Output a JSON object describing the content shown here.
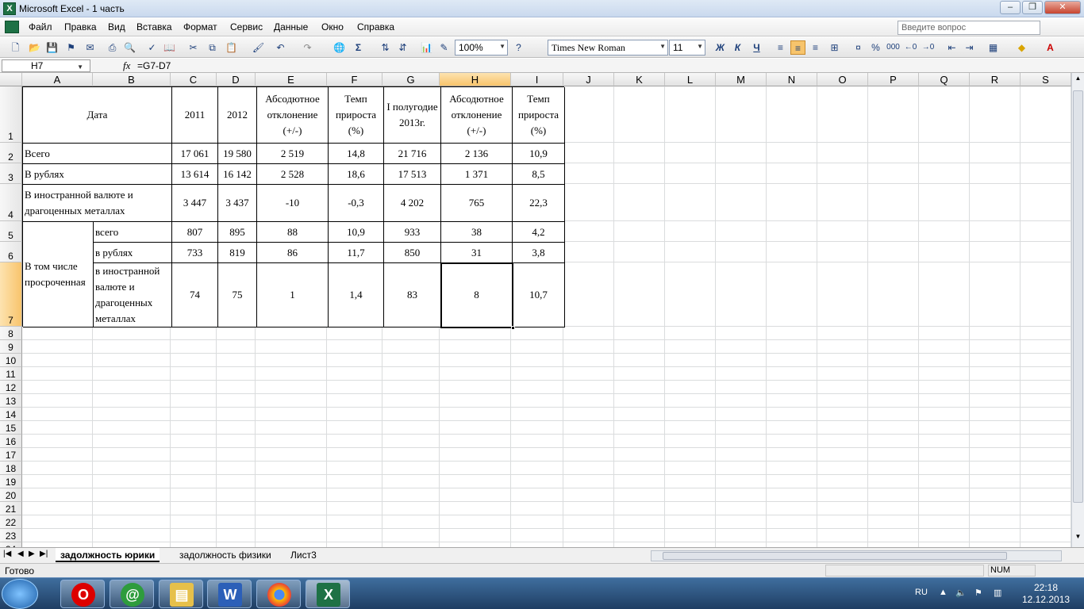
{
  "window": {
    "title": "Microsoft Excel - 1 часть",
    "app_icon": "X",
    "min": "–",
    "restore": "❐",
    "close": "✕"
  },
  "menu": {
    "items": [
      "Файл",
      "Правка",
      "Вид",
      "Вставка",
      "Формат",
      "Сервис",
      "Данные",
      "Окно",
      "Справка"
    ],
    "help_placeholder": "Введите вопрос"
  },
  "toolbar": {
    "zoom": "100%",
    "font": "Times New Roman",
    "size": "11",
    "bold": "Ж",
    "italic": "К",
    "underline": "Ч",
    "sigma": "Σ"
  },
  "formula": {
    "cell_ref": "H7",
    "fx": "fx",
    "value": "=G7-D7"
  },
  "columns": [
    "A",
    "B",
    "C",
    "D",
    "E",
    "F",
    "G",
    "H",
    "I",
    "J",
    "K",
    "L",
    "M",
    "N",
    "O",
    "P",
    "Q",
    "R",
    "S"
  ],
  "selected_column": "H",
  "rows": [
    "1",
    "2",
    "3",
    "4",
    "5",
    "6",
    "7",
    "8",
    "9",
    "10",
    "11",
    "12",
    "13",
    "14",
    "15",
    "16",
    "17",
    "18",
    "19",
    "20",
    "21",
    "22",
    "23",
    "24"
  ],
  "selected_row": "7",
  "table": {
    "header": {
      "date": "Дата",
      "y2011": "2011",
      "y2012": "2012",
      "abs1": "Абсодютное отклонение (+/-)",
      "rate1": "Темп прироста (%)",
      "h2013": "I полугодие 2013г.",
      "abs2": "Абсодютное отклонение (+/-)",
      "rate2": "Темп прироста (%)"
    },
    "r2": {
      "label": "Всего",
      "c": "17 061",
      "d": "19 580",
      "e": "2 519",
      "f": "14,8",
      "g": "21 716",
      "h": "2 136",
      "i": "10,9"
    },
    "r3": {
      "label": "В рублях",
      "c": "13 614",
      "d": "16 142",
      "e": "2 528",
      "f": "18,6",
      "g": "17 513",
      "h": "1 371",
      "i": "8,5"
    },
    "r4": {
      "label": "В иностранной валюте и драгоценных металлах",
      "c": "3 447",
      "d": "3 437",
      "e": "-10",
      "f": "-0,3",
      "g": "4 202",
      "h": "765",
      "i": "22,3"
    },
    "group_label": "В том числе просроченная",
    "r5": {
      "label": "всего",
      "c": "807",
      "d": "895",
      "e": "88",
      "f": "10,9",
      "g": "933",
      "h": "38",
      "i": "4,2"
    },
    "r6": {
      "label": "в рублях",
      "c": "733",
      "d": "819",
      "e": "86",
      "f": "11,7",
      "g": "850",
      "h": "31",
      "i": "3,8"
    },
    "r7": {
      "label": "в иностранной валюте и драгоценных металлах",
      "c": "74",
      "d": "75",
      "e": "1",
      "f": "1,4",
      "g": "83",
      "h": "8",
      "i": "10,7"
    }
  },
  "sheets": [
    "задолжность юрики",
    "задолжность физики",
    "Лист3"
  ],
  "status": {
    "ready": "Готово",
    "num": "NUM"
  },
  "taskbar": {
    "lang": "RU",
    "time": "22:18",
    "date": "12.12.2013",
    "apps": [
      "opera-icon",
      "agent-icon",
      "explorer-icon",
      "word-icon",
      "chrome-icon",
      "excel-icon"
    ]
  }
}
